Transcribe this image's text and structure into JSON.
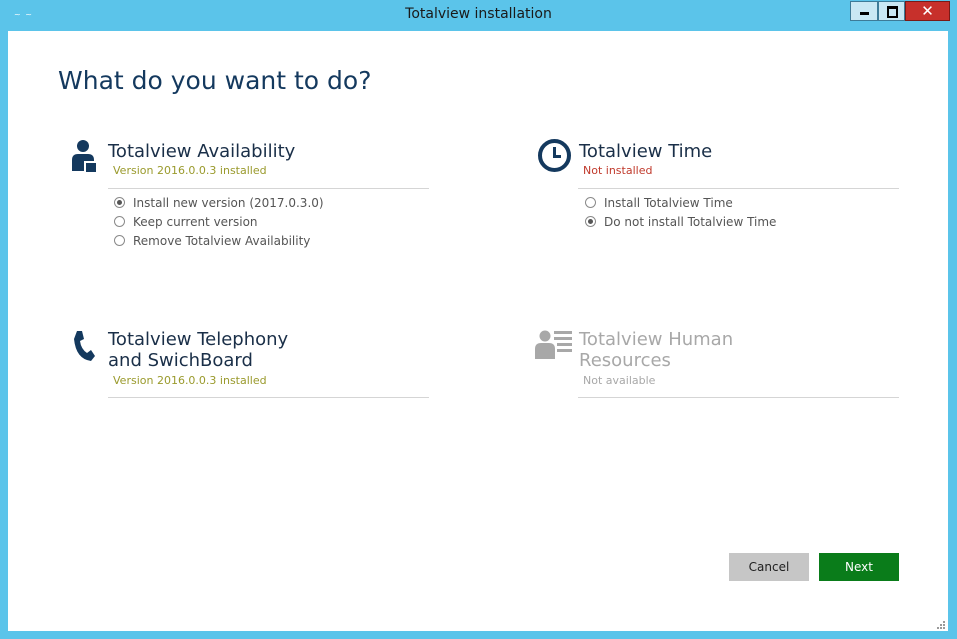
{
  "window": {
    "title": "Totalview installation",
    "app_icon_text": "~ ~",
    "close_glyph": "✕"
  },
  "page": {
    "heading": "What do you want to do?"
  },
  "cards": {
    "availability": {
      "title": "Totalview Availability",
      "status": "Version 2016.0.0.3 installed",
      "icon": "person-document-icon",
      "options": [
        {
          "label": "Install new version (2017.0.3.0)",
          "checked": true
        },
        {
          "label": "Keep current version",
          "checked": false
        },
        {
          "label": "Remove Totalview Availability",
          "checked": false
        }
      ]
    },
    "time": {
      "title": "Totalview Time",
      "status": "Not installed",
      "icon": "clock-icon",
      "options": [
        {
          "label": "Install Totalview Time",
          "checked": false
        },
        {
          "label": "Do not install Totalview Time",
          "checked": true
        }
      ]
    },
    "telephony": {
      "title_line1": "Totalview Telephony",
      "title_line2": "and SwichBoard",
      "status": "Version 2016.0.0.3 installed",
      "icon": "phone-icon"
    },
    "hr": {
      "title_line1": "Totalview Human",
      "title_line2": "Resources",
      "status": "Not available",
      "icon": "person-list-icon"
    }
  },
  "buttons": {
    "cancel": "Cancel",
    "next": "Next"
  },
  "colors": {
    "titlebar": "#5bc4ea",
    "heading": "#14395e",
    "icon_blue": "#14395e",
    "status_installed": "#9a9a2c",
    "status_not_installed": "#c0392b",
    "disabled": "#a8a8a8",
    "next_button": "#0a7c1a",
    "cancel_button": "#c6c6c6"
  }
}
